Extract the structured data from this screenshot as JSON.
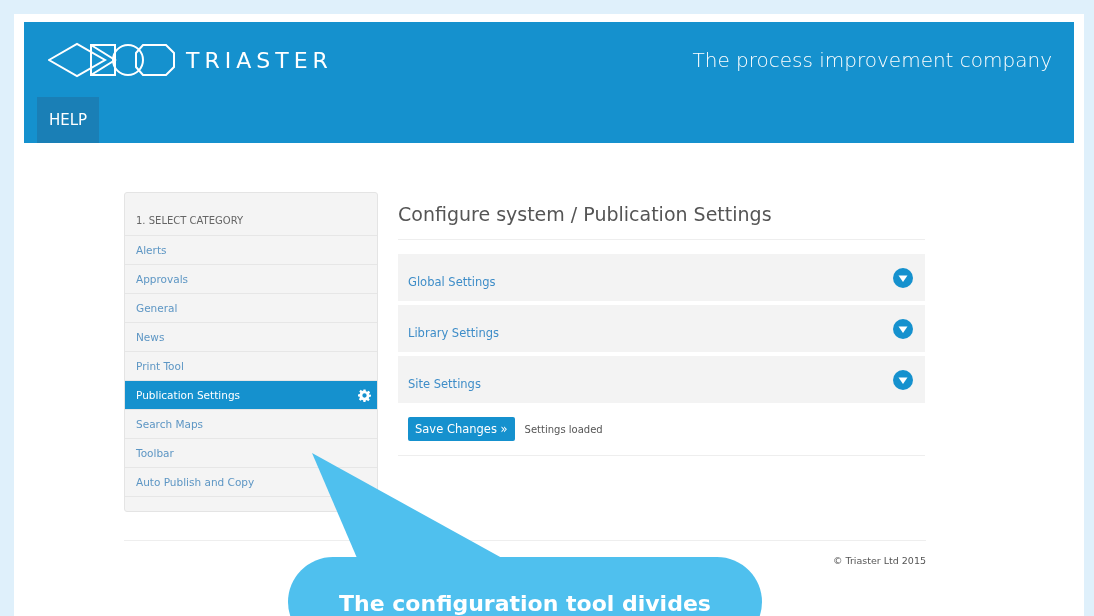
{
  "header": {
    "brand": "TRIASTER",
    "tagline": "The process improvement company",
    "nav": [
      {
        "label": "HELP",
        "selected": true
      }
    ]
  },
  "sidebar": {
    "heading": "1. SELECT CATEGORY",
    "items": [
      {
        "label": "Alerts",
        "selected": false
      },
      {
        "label": "Approvals",
        "selected": false
      },
      {
        "label": "General",
        "selected": false
      },
      {
        "label": "News",
        "selected": false
      },
      {
        "label": "Print Tool",
        "selected": false
      },
      {
        "label": "Publication Settings",
        "selected": true
      },
      {
        "label": "Search Maps",
        "selected": false
      },
      {
        "label": "Toolbar",
        "selected": false
      },
      {
        "label": "Auto Publish and Copy",
        "selected": false
      }
    ]
  },
  "main": {
    "title": "Configure system / Publication Settings",
    "sections": [
      {
        "label": "Global Settings",
        "expanded": false
      },
      {
        "label": "Library Settings",
        "expanded": false
      },
      {
        "label": "Site Settings",
        "expanded": false
      }
    ],
    "save_button": "Save Changes »",
    "status": "Settings loaded"
  },
  "footer": {
    "copyright": "© Triaster Ltd 2015"
  },
  "callout": {
    "text": "The configuration tool divides"
  }
}
